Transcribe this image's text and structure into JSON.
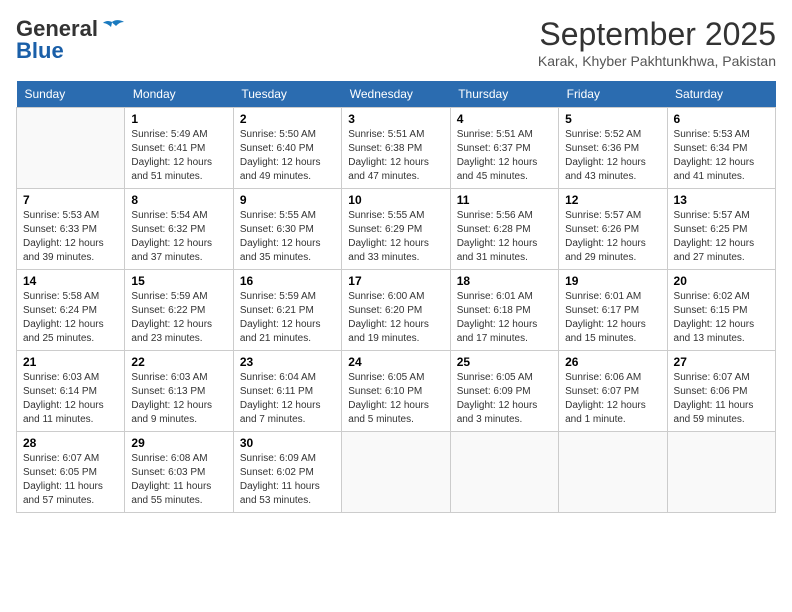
{
  "header": {
    "logo_line1": "General",
    "logo_line2": "Blue",
    "month": "September 2025",
    "location": "Karak, Khyber Pakhtunkhwa, Pakistan"
  },
  "weekdays": [
    "Sunday",
    "Monday",
    "Tuesday",
    "Wednesday",
    "Thursday",
    "Friday",
    "Saturday"
  ],
  "weeks": [
    [
      {
        "day": null
      },
      {
        "day": 1,
        "sunrise": "5:49 AM",
        "sunset": "6:41 PM",
        "daylight": "12 hours and 51 minutes."
      },
      {
        "day": 2,
        "sunrise": "5:50 AM",
        "sunset": "6:40 PM",
        "daylight": "12 hours and 49 minutes."
      },
      {
        "day": 3,
        "sunrise": "5:51 AM",
        "sunset": "6:38 PM",
        "daylight": "12 hours and 47 minutes."
      },
      {
        "day": 4,
        "sunrise": "5:51 AM",
        "sunset": "6:37 PM",
        "daylight": "12 hours and 45 minutes."
      },
      {
        "day": 5,
        "sunrise": "5:52 AM",
        "sunset": "6:36 PM",
        "daylight": "12 hours and 43 minutes."
      },
      {
        "day": 6,
        "sunrise": "5:53 AM",
        "sunset": "6:34 PM",
        "daylight": "12 hours and 41 minutes."
      }
    ],
    [
      {
        "day": 7,
        "sunrise": "5:53 AM",
        "sunset": "6:33 PM",
        "daylight": "12 hours and 39 minutes."
      },
      {
        "day": 8,
        "sunrise": "5:54 AM",
        "sunset": "6:32 PM",
        "daylight": "12 hours and 37 minutes."
      },
      {
        "day": 9,
        "sunrise": "5:55 AM",
        "sunset": "6:30 PM",
        "daylight": "12 hours and 35 minutes."
      },
      {
        "day": 10,
        "sunrise": "5:55 AM",
        "sunset": "6:29 PM",
        "daylight": "12 hours and 33 minutes."
      },
      {
        "day": 11,
        "sunrise": "5:56 AM",
        "sunset": "6:28 PM",
        "daylight": "12 hours and 31 minutes."
      },
      {
        "day": 12,
        "sunrise": "5:57 AM",
        "sunset": "6:26 PM",
        "daylight": "12 hours and 29 minutes."
      },
      {
        "day": 13,
        "sunrise": "5:57 AM",
        "sunset": "6:25 PM",
        "daylight": "12 hours and 27 minutes."
      }
    ],
    [
      {
        "day": 14,
        "sunrise": "5:58 AM",
        "sunset": "6:24 PM",
        "daylight": "12 hours and 25 minutes."
      },
      {
        "day": 15,
        "sunrise": "5:59 AM",
        "sunset": "6:22 PM",
        "daylight": "12 hours and 23 minutes."
      },
      {
        "day": 16,
        "sunrise": "5:59 AM",
        "sunset": "6:21 PM",
        "daylight": "12 hours and 21 minutes."
      },
      {
        "day": 17,
        "sunrise": "6:00 AM",
        "sunset": "6:20 PM",
        "daylight": "12 hours and 19 minutes."
      },
      {
        "day": 18,
        "sunrise": "6:01 AM",
        "sunset": "6:18 PM",
        "daylight": "12 hours and 17 minutes."
      },
      {
        "day": 19,
        "sunrise": "6:01 AM",
        "sunset": "6:17 PM",
        "daylight": "12 hours and 15 minutes."
      },
      {
        "day": 20,
        "sunrise": "6:02 AM",
        "sunset": "6:15 PM",
        "daylight": "12 hours and 13 minutes."
      }
    ],
    [
      {
        "day": 21,
        "sunrise": "6:03 AM",
        "sunset": "6:14 PM",
        "daylight": "12 hours and 11 minutes."
      },
      {
        "day": 22,
        "sunrise": "6:03 AM",
        "sunset": "6:13 PM",
        "daylight": "12 hours and 9 minutes."
      },
      {
        "day": 23,
        "sunrise": "6:04 AM",
        "sunset": "6:11 PM",
        "daylight": "12 hours and 7 minutes."
      },
      {
        "day": 24,
        "sunrise": "6:05 AM",
        "sunset": "6:10 PM",
        "daylight": "12 hours and 5 minutes."
      },
      {
        "day": 25,
        "sunrise": "6:05 AM",
        "sunset": "6:09 PM",
        "daylight": "12 hours and 3 minutes."
      },
      {
        "day": 26,
        "sunrise": "6:06 AM",
        "sunset": "6:07 PM",
        "daylight": "12 hours and 1 minute."
      },
      {
        "day": 27,
        "sunrise": "6:07 AM",
        "sunset": "6:06 PM",
        "daylight": "11 hours and 59 minutes."
      }
    ],
    [
      {
        "day": 28,
        "sunrise": "6:07 AM",
        "sunset": "6:05 PM",
        "daylight": "11 hours and 57 minutes."
      },
      {
        "day": 29,
        "sunrise": "6:08 AM",
        "sunset": "6:03 PM",
        "daylight": "11 hours and 55 minutes."
      },
      {
        "day": 30,
        "sunrise": "6:09 AM",
        "sunset": "6:02 PM",
        "daylight": "11 hours and 53 minutes."
      },
      {
        "day": null
      },
      {
        "day": null
      },
      {
        "day": null
      },
      {
        "day": null
      }
    ]
  ]
}
